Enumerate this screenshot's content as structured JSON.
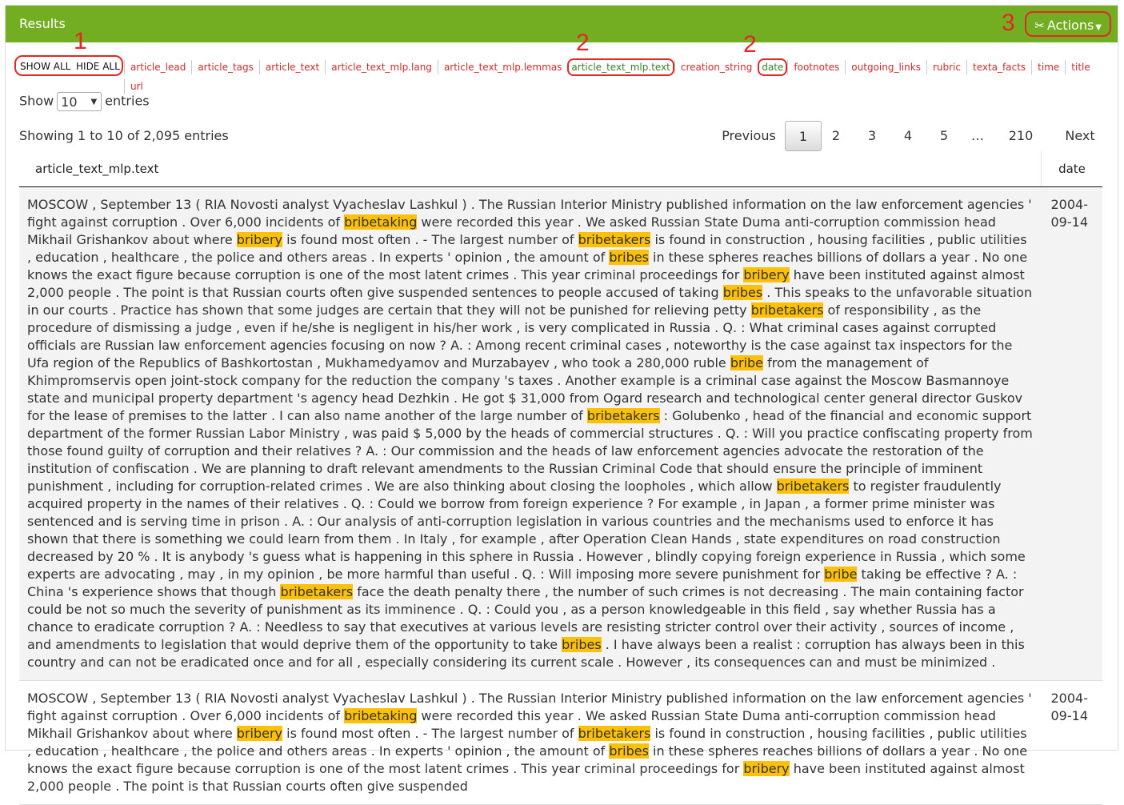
{
  "header": {
    "title": "Results",
    "actions_label": "Actions"
  },
  "annotations": {
    "a1": "1",
    "a2": "2",
    "a3": "2",
    "a4": "3"
  },
  "toggles": {
    "show_all": "SHOW ALL",
    "hide_all": "HIDE ALL"
  },
  "columns": [
    "article_lead",
    "article_tags",
    "article_text",
    "article_text_mlp.lang",
    "article_text_mlp.lemmas",
    "article_text_mlp.text",
    "creation_string",
    "date",
    "footnotes",
    "outgoing_links",
    "rubric",
    "texta_facts",
    "time",
    "title",
    "url"
  ],
  "length": {
    "show": "Show",
    "value": "10",
    "entries": "entries"
  },
  "info": "Showing 1 to 10 of 2,095 entries",
  "pagination": [
    "Previous",
    "1",
    "2",
    "3",
    "4",
    "5",
    "…",
    "210",
    "Next"
  ],
  "table": {
    "headers": [
      "article_text_mlp.text",
      "date"
    ],
    "rows": [
      {
        "date": "2004-09-14",
        "segments": [
          {
            "t": "MOSCOW , September 13 ( RIA Novosti analyst Vyacheslav Lashkul ) . The Russian Interior Ministry published information on the law enforcement agencies ' fight against corruption . Over 6,000 incidents of "
          },
          {
            "t": "bribetaking",
            "h": true
          },
          {
            "t": " were recorded this year . We asked Russian State Duma anti-corruption commission head Mikhail Grishankov about where "
          },
          {
            "t": "bribery",
            "h": true
          },
          {
            "t": " is found most often . - The largest number of "
          },
          {
            "t": "bribetakers",
            "h": true
          },
          {
            "t": " is found in construction , housing facilities , public utilities , education , healthcare , the police and others areas . In experts ' opinion , the amount of "
          },
          {
            "t": "bribes",
            "h": true
          },
          {
            "t": " in these spheres reaches billions of dollars a year . No one knows the exact figure because corruption is one of the most latent crimes . This year criminal proceedings for "
          },
          {
            "t": "bribery",
            "h": true
          },
          {
            "t": " have been instituted against almost 2,000 people . The point is that Russian courts often give suspended sentences to people accused of taking "
          },
          {
            "t": "bribes",
            "h": true
          },
          {
            "t": " . This speaks to the unfavorable situation in our courts . Practice has shown that some judges are certain that they will not be punished for relieving petty "
          },
          {
            "t": "bribetakers",
            "h": true
          },
          {
            "t": " of responsibility , as the procedure of dismissing a judge , even if he/she is negligent in his/her work , is very complicated in Russia . Q. : What criminal cases against corrupted officials are Russian law enforcement agencies focusing on now ? A. : Among recent criminal cases , noteworthy is the case against tax inspectors for the Ufa region of the Republics of Bashkortostan , Mukhamedyamov and Murzabayev , who took a 280,000 ruble "
          },
          {
            "t": "bribe",
            "h": true
          },
          {
            "t": " from the management of Khimpromservis open joint-stock company for the reduction the company 's taxes . Another example is a criminal case against the Moscow Basmannoye state and municipal property department 's agency head Dezhkin . He got $ 31,000 from Ogard research and technological center general director Guskov for the lease of premises to the latter . I can also name another of the large number of "
          },
          {
            "t": "bribetakers",
            "h": true
          },
          {
            "t": " : Golubenko , head of the financial and economic support department of the former Russian Labor Ministry , was paid $ 5,000 by the heads of commercial structures . Q. : Will you practice confiscating property from those found guilty of corruption and their relatives ? A. : Our commission and the heads of law enforcement agencies advocate the restoration of the institution of confiscation . We are planning to draft relevant amendments to the Russian Criminal Code that should ensure the principle of imminent punishment , including for corruption-related crimes . We are also thinking about closing the loopholes , which allow "
          },
          {
            "t": "bribetakers",
            "h": true
          },
          {
            "t": " to register fraudulently acquired property in the names of their relatives . Q. : Could we borrow from foreign experience ? For example , in Japan , a former prime minister was sentenced and is serving time in prison . A. : Our analysis of anti-corruption legislation in various countries and the mechanisms used to enforce it has shown that there is something we could learn from them . In Italy , for example , after Operation Clean Hands , state expenditures on road construction decreased by 20 % . It is anybody 's guess what is happening in this sphere in Russia . However , blindly copying foreign experience in Russia , which some experts are advocating , may , in my opinion , be more harmful than useful . Q. : Will imposing more severe punishment for "
          },
          {
            "t": "bribe",
            "h": true
          },
          {
            "t": " taking be effective ? A. : China 's experience shows that though "
          },
          {
            "t": "bribetakers",
            "h": true
          },
          {
            "t": " face the death penalty there , the number of such crimes is not decreasing . The main containing factor could be not so much the severity of punishment as its imminence . Q. : Could you , as a person knowledgeable in this field , say whether Russia has a chance to eradicate corruption ? A. : Needless to say that executives at various levels are resisting stricter control over their activity , sources of income , and amendments to legislation that would deprive them of the opportunity to take "
          },
          {
            "t": "bribes",
            "h": true
          },
          {
            "t": " . I have always been a realist : corruption has always been in this country and can not be eradicated once and for all , especially considering its current scale . However , its consequences can and must be minimized ."
          }
        ]
      },
      {
        "date": "2004-09-14",
        "segments": [
          {
            "t": "MOSCOW , September 13 ( RIA Novosti analyst Vyacheslav Lashkul ) . The Russian Interior Ministry published information on the law enforcement agencies ' fight against corruption . Over 6,000 incidents of "
          },
          {
            "t": "bribetaking",
            "h": true
          },
          {
            "t": " were recorded this year . We asked Russian State Duma anti-corruption commission head Mikhail Grishankov about where "
          },
          {
            "t": "bribery",
            "h": true
          },
          {
            "t": " is found most often . - The largest number of "
          },
          {
            "t": "bribetakers",
            "h": true
          },
          {
            "t": " is found in construction , housing facilities , public utilities , education , healthcare , the police and others areas . In experts ' opinion , the amount of "
          },
          {
            "t": "bribes",
            "h": true
          },
          {
            "t": " in these spheres reaches billions of dollars a year . No one knows the exact figure because corruption is one of the most latent crimes . This year criminal proceedings for "
          },
          {
            "t": "bribery",
            "h": true
          },
          {
            "t": " have been instituted against almost 2,000 people . The point is that Russian courts often give suspended"
          }
        ]
      }
    ]
  }
}
